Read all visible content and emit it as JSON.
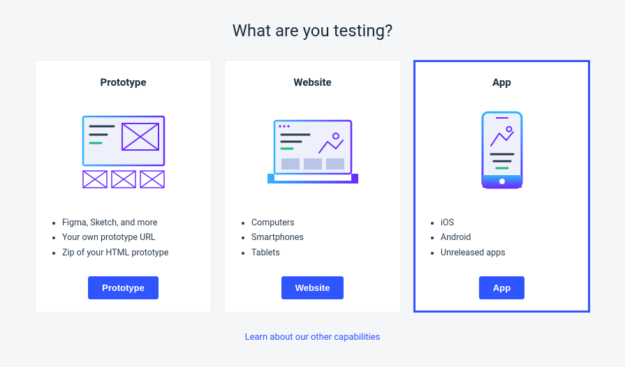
{
  "heading": "What are you testing?",
  "cards": [
    {
      "title": "Prototype",
      "features": [
        "Figma, Sketch, and more",
        "Your own prototype URL",
        "Zip of your HTML prototype"
      ],
      "button": "Prototype"
    },
    {
      "title": "Website",
      "features": [
        "Computers",
        "Smartphones",
        "Tablets"
      ],
      "button": "Website"
    },
    {
      "title": "App",
      "features": [
        "iOS",
        "Android",
        "Unreleased apps"
      ],
      "button": "App"
    }
  ],
  "footer_link": "Learn about our other capabilities",
  "selected_index": 2
}
